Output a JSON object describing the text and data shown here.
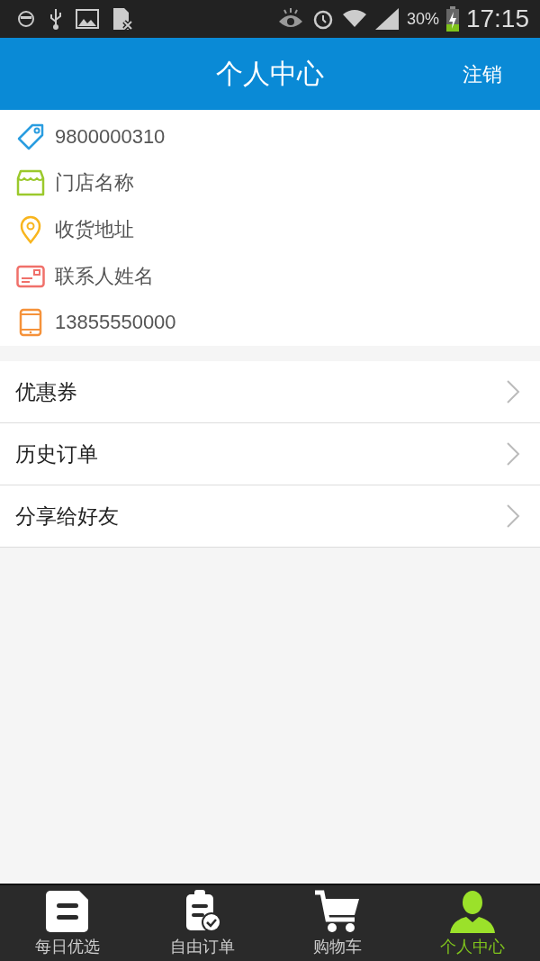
{
  "status_bar": {
    "battery": "30%",
    "time": "17:15"
  },
  "header": {
    "title": "个人中心",
    "action": "注销"
  },
  "info": [
    {
      "kind": "tag",
      "text": "9800000310"
    },
    {
      "kind": "store",
      "text": "门店名称"
    },
    {
      "kind": "pin",
      "text": "收货地址"
    },
    {
      "kind": "card",
      "text": "联系人姓名"
    },
    {
      "kind": "phone",
      "text": "13855550000"
    }
  ],
  "menu": [
    {
      "label": "优惠券"
    },
    {
      "label": "历史订单"
    },
    {
      "label": "分享给好友"
    }
  ],
  "tabs": [
    {
      "kind": "daily",
      "label": "每日优选",
      "selected": false
    },
    {
      "kind": "order",
      "label": "自由订单",
      "selected": false
    },
    {
      "kind": "cart",
      "label": "购物车",
      "selected": false
    },
    {
      "kind": "user",
      "label": "个人中心",
      "selected": true
    }
  ]
}
